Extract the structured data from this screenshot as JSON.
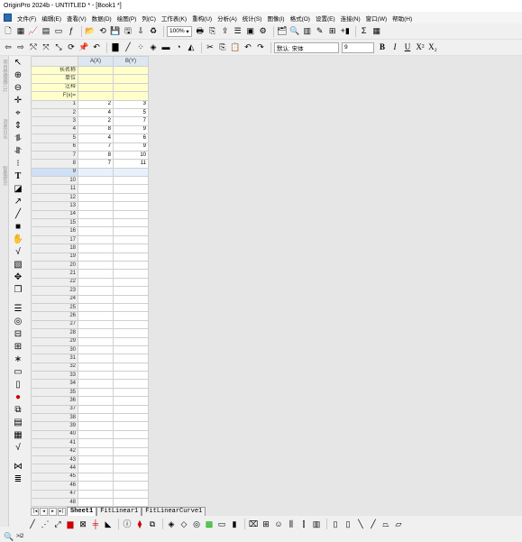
{
  "window": {
    "title": "OriginPro 2024b - UNTITLED * - [Book1 *]"
  },
  "menu": [
    "文件(F)",
    "编辑(E)",
    "查看(V)",
    "数据(D)",
    "绘图(P)",
    "列(C)",
    "工作表(K)",
    "重构(U)",
    "分析(A)",
    "统计(S)",
    "图像(I)",
    "格式(O)",
    "设置(E)",
    "连接(N)",
    "窗口(W)",
    "帮助(H)"
  ],
  "toolbar": {
    "zoom_value": "100%",
    "font_name": "默认: 宋体",
    "font_size": "9",
    "bold": "B",
    "italic": "I",
    "underline": "U",
    "superscript": "X²",
    "subscript": "X₂"
  },
  "sidebar": {
    "labels": [
      "项目管理器 (1)",
      "消息日志",
      "智能提示"
    ]
  },
  "sheet": {
    "col_headers": [
      "A(X)",
      "B(Y)"
    ],
    "meta_rows": [
      "长名称",
      "单位",
      "注释",
      "F(x)="
    ],
    "rows": [
      [
        "1",
        "2",
        "3"
      ],
      [
        "2",
        "4",
        "5"
      ],
      [
        "3",
        "2",
        "7"
      ],
      [
        "4",
        "8",
        "9"
      ],
      [
        "5",
        "4",
        "6"
      ],
      [
        "6",
        "7",
        "9"
      ],
      [
        "7",
        "8",
        "10"
      ],
      [
        "8",
        "7",
        "11"
      ],
      [
        "9",
        "",
        ""
      ],
      [
        "10",
        "",
        ""
      ],
      [
        "11",
        "",
        ""
      ],
      [
        "12",
        "",
        ""
      ],
      [
        "13",
        "",
        ""
      ],
      [
        "14",
        "",
        ""
      ],
      [
        "15",
        "",
        ""
      ],
      [
        "16",
        "",
        ""
      ],
      [
        "17",
        "",
        ""
      ],
      [
        "18",
        "",
        ""
      ],
      [
        "19",
        "",
        ""
      ],
      [
        "20",
        "",
        ""
      ],
      [
        "21",
        "",
        ""
      ],
      [
        "22",
        "",
        ""
      ],
      [
        "23",
        "",
        ""
      ],
      [
        "24",
        "",
        ""
      ],
      [
        "25",
        "",
        ""
      ],
      [
        "26",
        "",
        ""
      ],
      [
        "27",
        "",
        ""
      ],
      [
        "28",
        "",
        ""
      ],
      [
        "29",
        "",
        ""
      ],
      [
        "30",
        "",
        ""
      ],
      [
        "31",
        "",
        ""
      ],
      [
        "32",
        "",
        ""
      ],
      [
        "33",
        "",
        ""
      ],
      [
        "34",
        "",
        ""
      ],
      [
        "35",
        "",
        ""
      ],
      [
        "36",
        "",
        ""
      ],
      [
        "37",
        "",
        ""
      ],
      [
        "38",
        "",
        ""
      ],
      [
        "39",
        "",
        ""
      ],
      [
        "40",
        "",
        ""
      ],
      [
        "41",
        "",
        ""
      ],
      [
        "42",
        "",
        ""
      ],
      [
        "43",
        "",
        ""
      ],
      [
        "44",
        "",
        ""
      ],
      [
        "45",
        "",
        ""
      ],
      [
        "46",
        "",
        ""
      ],
      [
        "47",
        "",
        ""
      ],
      [
        "48",
        "",
        ""
      ]
    ],
    "selected_row": "9"
  },
  "tabs": {
    "items": [
      "Sheet1",
      "FitLinear1",
      "FitLinearCurve1"
    ],
    "active": "Sheet1"
  },
  "status": {
    "text": ">i2"
  }
}
